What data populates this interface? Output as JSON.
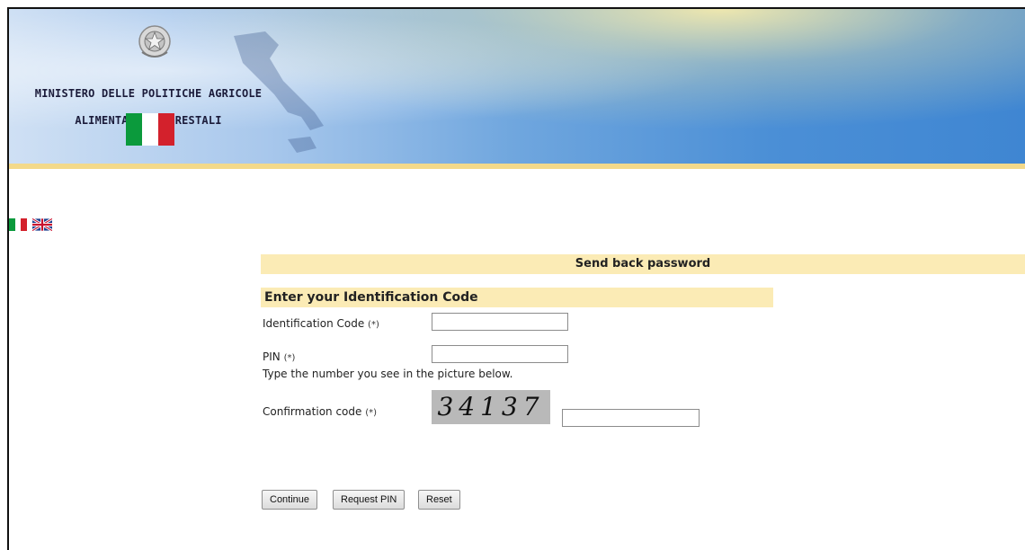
{
  "header": {
    "ministry_line1": "MINISTERO DELLE POLITICHE AGRICOLE",
    "ministry_line2": "ALIMENTARI E FORESTALI"
  },
  "languages": [
    "Italiano",
    "English"
  ],
  "page_title": "Send back password",
  "section_title": "Enter your Identification Code",
  "form": {
    "identification_code_label": "Identification Code",
    "pin_label": "PIN",
    "required_marker": "(*)",
    "captcha_instruction": "Type the number you see in the picture below.",
    "confirmation_code_label": "Confirmation code",
    "captcha_value": "34137",
    "identification_code_value": "",
    "pin_value": "",
    "confirmation_code_value": ""
  },
  "buttons": {
    "continue": "Continue",
    "request_pin": "Request PIN",
    "reset": "Reset"
  },
  "colors": {
    "accent_bar": "#fbebb5",
    "banner_blue": "#4b8fd6",
    "flag_green": "#0b9a3c",
    "flag_red": "#d3212c"
  }
}
